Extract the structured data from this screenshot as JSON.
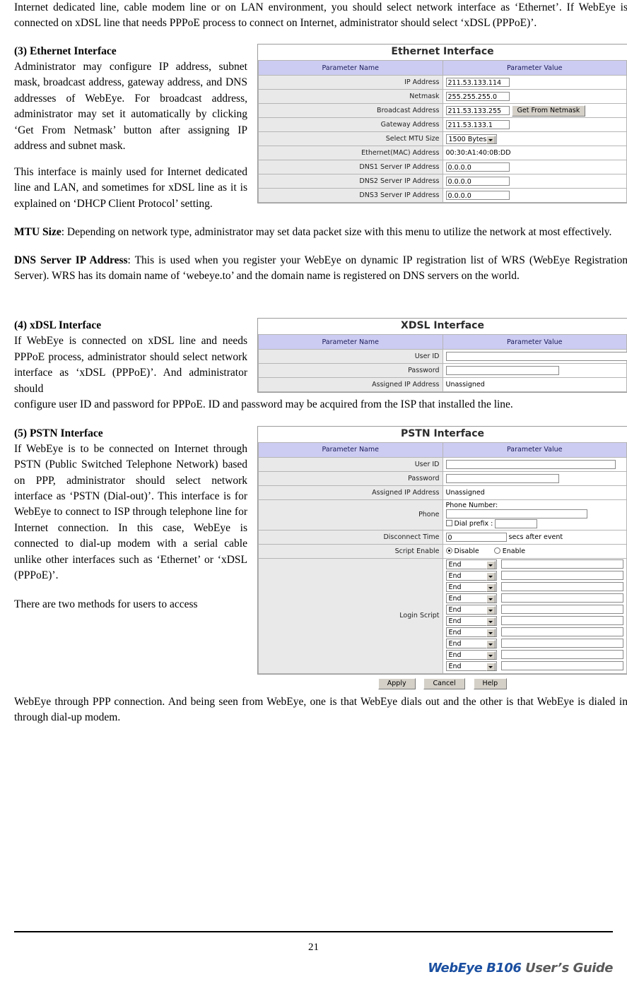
{
  "document": {
    "page_number": "21",
    "footer_brand_primary": "WebEye B106",
    "footer_brand_secondary": "User’s Guide",
    "intro_paragraph": "Internet dedicated line, cable modem line or on LAN environment, you should select network interface as ‘Ethernet’. If WebEye is connected on xDSL line that needs PPPoE process to connect on Internet, administrator should select ‘xDSL (PPPoE)’.",
    "sections": [
      {
        "heading": "(3) Ethernet Interface",
        "left_text": "Administrator may configure IP address, subnet mask, broadcast address, gateway address, and DNS addresses of WebEye. For broadcast address, administrator may set it automatically by clicking ‘Get From Netmask’ button after assigning IP address and subnet mask.",
        "below_text": "This interface is mainly used for Internet dedicated line and LAN, and sometimes for xDSL line as it is explained on ‘DHCP Client Protocol’ setting.",
        "notes": [
          {
            "term": "MTU Size",
            "text": ": Depending on network type, administrator may set data packet size with this menu to utilize the network at most effectively."
          },
          {
            "term": "DNS Server IP Address",
            "text": ": This is used when you register your WebEye on dynamic IP registration list of WRS (WebEye Registration Server). WRS has its domain name of ‘webeye.to’ and the domain name is registered on DNS servers on the world."
          }
        ]
      },
      {
        "heading": "(4) xDSL Interface",
        "left_text": "If WebEye is connected on xDSL line and needs PPPoE process, administrator should select network interface as ‘xDSL (PPPoE)’. And administrator should",
        "below_text": "configure user ID and password for PPPoE. ID and password may be acquired from the ISP that installed the line."
      },
      {
        "heading": "(5) PSTN Interface",
        "left_text": "If WebEye is to be connected on Internet through PSTN (Public Switched Telephone Network) based on PPP, administrator should select network interface as ‘PSTN (Dial-out)’. This interface is for WebEye to connect to ISP through telephone line for Internet connection. In this case, WebEye is connected to dial-up modem with a serial cable unlike other interfaces such as ‘Ethernet’ or ‘xDSL (PPPoE)’.",
        "below_text_left": "There are two methods for users to access",
        "below_text": "WebEye through PPP connection. And being seen from WebEye, one is that WebEye dials out and the other is that WebEye is dialed in through dial-up modem."
      }
    ]
  },
  "ethernet_figure": {
    "title": "Ethernet Interface",
    "columns": [
      "Parameter Name",
      "Parameter Value"
    ],
    "rows": [
      {
        "label": "IP Address",
        "value": "211.53.133.114",
        "type": "text"
      },
      {
        "label": "Netmask",
        "value": "255.255.255.0",
        "type": "text"
      },
      {
        "label": "Broadcast Address",
        "value": "211.53.133.255",
        "type": "text",
        "button": "Get From Netmask"
      },
      {
        "label": "Gateway Address",
        "value": "211.53.133.1",
        "type": "text"
      },
      {
        "label": "Select MTU Size",
        "value": "1500 Bytes",
        "type": "select"
      },
      {
        "label": "Ethernet(MAC) Address",
        "value": "00:30:A1:40:0B:DD",
        "type": "static"
      },
      {
        "label": "DNS1 Server IP Address",
        "value": "0.0.0.0",
        "type": "text"
      },
      {
        "label": "DNS2 Server IP Address",
        "value": "0.0.0.0",
        "type": "text"
      },
      {
        "label": "DNS3 Server IP Address",
        "value": "0.0.0.0",
        "type": "text"
      }
    ]
  },
  "xdsl_figure": {
    "title": "XDSL Interface",
    "columns": [
      "Parameter Name",
      "Parameter Value"
    ],
    "rows": [
      {
        "label": "User ID",
        "value": "",
        "type": "text"
      },
      {
        "label": "Password",
        "value": "",
        "type": "text"
      },
      {
        "label": "Assigned IP Address",
        "value": "Unassigned",
        "type": "static"
      }
    ]
  },
  "pstn_figure": {
    "title": "PSTN Interface",
    "columns": [
      "Parameter Name",
      "Parameter Value"
    ],
    "rows": [
      {
        "label": "User ID",
        "value": "",
        "type": "text"
      },
      {
        "label": "Password",
        "value": "",
        "type": "text"
      },
      {
        "label": "Assigned IP Address",
        "value": "Unassigned",
        "type": "static"
      }
    ],
    "phone_label": "Phone",
    "phone_number_label": "Phone Number:",
    "dial_prefix_label": "Dial prefix :",
    "disconnect_time_label": "Disconnect Time",
    "disconnect_time_value": "0",
    "disconnect_time_suffix": "secs after event",
    "script_enable_label": "Script Enable",
    "script_enable_options": [
      "Disable",
      "Enable"
    ],
    "script_enable_selected": "Disable",
    "login_script_label": "Login Script",
    "script_rows": [
      {
        "action": "End",
        "value": ""
      },
      {
        "action": "End",
        "value": ""
      },
      {
        "action": "End",
        "value": ""
      },
      {
        "action": "End",
        "value": ""
      },
      {
        "action": "End",
        "value": ""
      },
      {
        "action": "End",
        "value": ""
      },
      {
        "action": "End",
        "value": ""
      },
      {
        "action": "End",
        "value": ""
      },
      {
        "action": "End",
        "value": ""
      },
      {
        "action": "End",
        "value": ""
      }
    ],
    "buttons": [
      "Apply",
      "Cancel",
      "Help"
    ]
  }
}
